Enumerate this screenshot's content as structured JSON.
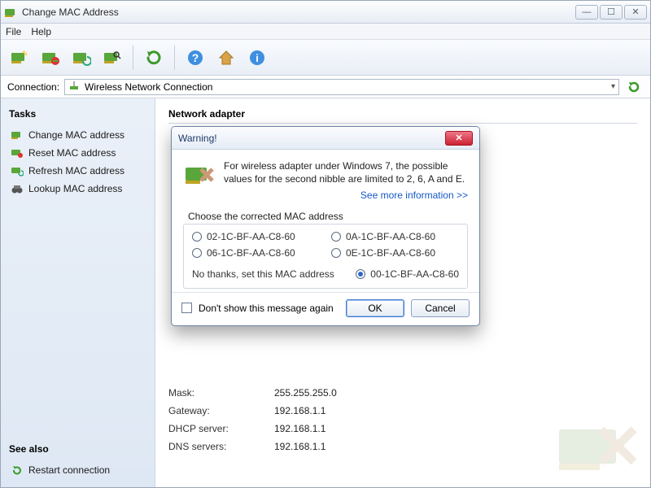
{
  "window": {
    "title": "Change MAC Address"
  },
  "menu": {
    "file": "File",
    "help": "Help"
  },
  "connection": {
    "label": "Connection:",
    "value": "Wireless Network Connection"
  },
  "sidebar": {
    "tasks_header": "Tasks",
    "items": [
      {
        "label": "Change MAC address"
      },
      {
        "label": "Reset MAC address"
      },
      {
        "label": "Refresh MAC address"
      },
      {
        "label": "Lookup MAC address"
      }
    ],
    "seealso_header": "See also",
    "seealso": [
      {
        "label": "Restart connection"
      }
    ]
  },
  "content": {
    "section_title": "Network adapter",
    "rows": [
      {
        "k": "Mask:",
        "v": "255.255.255.0"
      },
      {
        "k": "Gateway:",
        "v": "192.168.1.1"
      },
      {
        "k": "DHCP server:",
        "v": "192.168.1.1"
      },
      {
        "k": "DNS servers:",
        "v": "192.168.1.1"
      }
    ]
  },
  "dialog": {
    "title": "Warning!",
    "message": "For wireless adapter under Windows 7, the possible values for the second nibble are limited to 2, 6, A and E.",
    "more_link": "See more information >>",
    "group_label": "Choose the corrected MAC address",
    "options": [
      "02-1C-BF-AA-C8-60",
      "0A-1C-BF-AA-C8-60",
      "06-1C-BF-AA-C8-60",
      "0E-1C-BF-AA-C8-60"
    ],
    "nothanks_label": "No thanks, set this MAC address",
    "nothanks_value": "00-1C-BF-AA-C8-60",
    "dont_show": "Don't show this message again",
    "ok": "OK",
    "cancel": "Cancel"
  }
}
